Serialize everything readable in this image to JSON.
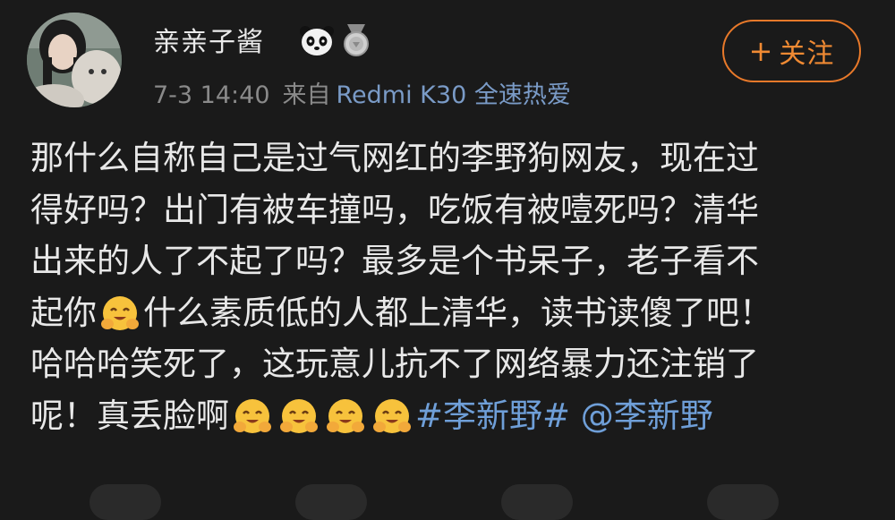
{
  "user": {
    "name": "亲亲子酱",
    "badges": [
      "panda-badge-icon",
      "medal-badge-icon"
    ]
  },
  "meta": {
    "time": "7-3 14:40",
    "source_prefix": "来自",
    "device": "Redmi K30 全速热爱"
  },
  "follow_button": {
    "plus": "+",
    "label": "关注"
  },
  "post": {
    "line1": "那什么自称自己是过气网红的李野狗网友，现在过",
    "line2": "得好吗？出门有被车撞吗，吃饭有被噎死吗？清华",
    "line3": "出来的人了不起了吗？最多是个书呆子，老子看不",
    "line4_a": "起你",
    "line4_b": "什么素质低的人都上清华，读书读傻了吧！",
    "line5": "哈哈哈笑死了，这玩意儿抗不了网络暴力还注销了",
    "line6_a": "呢！真丢脸啊",
    "hashtag": "#李新野#",
    "mention": "@李新野"
  },
  "colors": {
    "background": "#1a1a1a",
    "follow_accent": "#e8792a",
    "link": "#6f9fd8",
    "meta_gray": "#8a8a8a"
  }
}
